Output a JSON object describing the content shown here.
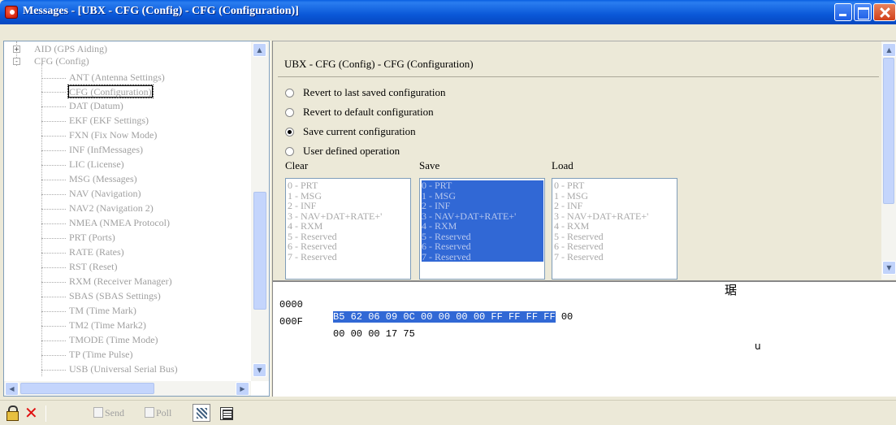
{
  "window": {
    "title": "Messages - [UBX - CFG (Config) - CFG (Configuration)]"
  },
  "tree": {
    "top_items": [
      {
        "label": "AID (GPS Aiding)",
        "expander": "+"
      },
      {
        "label": "CFG (Config)",
        "expander": "-"
      }
    ],
    "children": [
      "ANT (Antenna Settings)",
      "CFG (Configuration)",
      "DAT (Datum)",
      "EKF (EKF Settings)",
      "FXN (Fix Now Mode)",
      "INF (InfMessages)",
      "LIC (License)",
      "MSG (Messages)",
      "NAV (Navigation)",
      "NAV2 (Navigation 2)",
      "NMEA (NMEA Protocol)",
      "PRT (Ports)",
      "RATE (Rates)",
      "RST (Reset)",
      "RXM (Receiver Manager)",
      "SBAS (SBAS Settings)",
      "TM (Time Mark)",
      "TM2 (Time Mark2)",
      "TMODE (Time Mode)",
      "TP (Time Pulse)",
      "USB (Universal Serial Bus)"
    ],
    "selected": "CFG (Configuration)"
  },
  "config": {
    "header": "UBX - CFG (Config) - CFG (Configuration)",
    "options": [
      {
        "label": "Revert to last saved configuration",
        "checked": false
      },
      {
        "label": "Revert to default configuration",
        "checked": false
      },
      {
        "label": "Save current configuration",
        "checked": true
      },
      {
        "label": "User defined operation",
        "checked": false
      }
    ],
    "lists": [
      {
        "title": "Clear",
        "selected_all": false
      },
      {
        "title": "Save",
        "selected_all": true
      },
      {
        "title": "Load",
        "selected_all": false
      }
    ],
    "list_options": [
      "0 - PRT",
      "1 - MSG",
      "2 - INF",
      "3 - NAV+DAT+RATE+'",
      "4 - RXM",
      "5 - Reserved",
      "6 - Reserved",
      "7 - Reserved"
    ]
  },
  "hex": {
    "rows": [
      {
        "offset": "0000",
        "selected": "B5 62 06 09 0C 00 00 00 00 FF FF FF FF",
        "rest": " 00",
        "ascii": "琚"
      },
      {
        "offset": "000F",
        "selected": "",
        "rest": "00 00 00 17 75",
        "ascii": "u"
      }
    ]
  },
  "toolbar": {
    "send_label": "Send",
    "poll_label": "Poll"
  }
}
